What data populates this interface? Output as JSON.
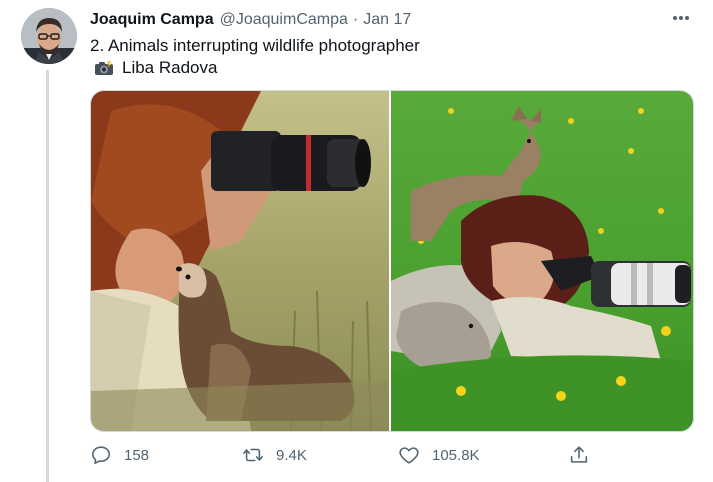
{
  "tweet": {
    "author_name": "Joaquim Campa",
    "handle": "@JoaquimCampa",
    "separator": "·",
    "date": "Jan 17",
    "text_line1": "2. Animals interrupting wildlife photographer",
    "credit_name": "Liba Radova",
    "credit_icon": "camera-with-flash-emoji"
  },
  "media": {
    "left_photo_description_icon": "photo",
    "right_photo_description_icon": "photo"
  },
  "actions": {
    "reply_count": "158",
    "retweet_count": "9.4K",
    "like_count": "105.8K"
  },
  "colors": {
    "text_primary": "#0f1419",
    "text_secondary": "#536471",
    "divider": "#cfd9de"
  }
}
